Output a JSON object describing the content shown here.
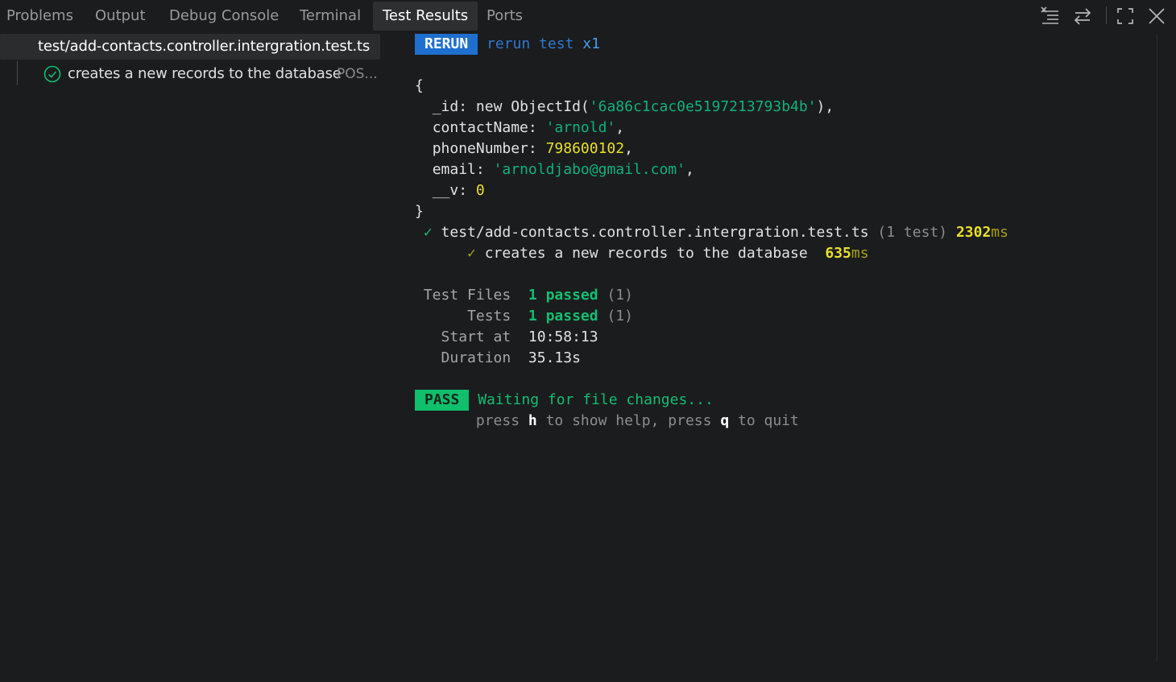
{
  "panel_tabs": [
    {
      "label": "Problems"
    },
    {
      "label": "Output"
    },
    {
      "label": "Debug Console"
    },
    {
      "label": "Terminal"
    },
    {
      "label": "Test Results"
    },
    {
      "label": "Ports"
    }
  ],
  "active_tab": "Test Results",
  "toolbar_icons": [
    "clear-list-icon",
    "toggle-output-icon",
    "maximize-icon",
    "close-icon"
  ],
  "test_tree": {
    "file": "test/add-contacts.controller.intergration.test.ts",
    "test": {
      "label": "creates a new records to the database",
      "description": "POS...",
      "status": "passed"
    }
  },
  "terminal": {
    "rerun_badge": "RERUN",
    "rerun_text": "rerun test",
    "rerun_count": "x1",
    "open_brace": "{",
    "record": {
      "id_key": "_id:",
      "id_call": "new ObjectId(",
      "id_value": "'6a86c1cac0e5197213793b4b'",
      "id_close": "),",
      "name_key": "contactName:",
      "name_value": "'arnold'",
      "phone_key": "phoneNumber:",
      "phone_value": "798600102",
      "email_key": "email:",
      "email_value": "'arnoldjabo@gmail.com'",
      "v_key": "__v:",
      "v_value": "0",
      "comma": ","
    },
    "close_brace": "}",
    "check_mark": "✓",
    "file_result": {
      "path": "test/add-contacts.controller.intergration.test.ts",
      "count": "(1 test)",
      "time": "2302",
      "unit": "ms"
    },
    "test_result": {
      "name": "creates a new records to the database",
      "time": "635",
      "unit": "ms"
    },
    "summary": {
      "files_label": "Test Files",
      "files_value": "1 passed",
      "files_count": "(1)",
      "tests_label": "Tests",
      "tests_value": "1 passed",
      "tests_count": "(1)",
      "start_label": "Start at",
      "start_value": "10:58:13",
      "duration_label": "Duration",
      "duration_value": "35.13s"
    },
    "pass_badge": "PASS",
    "waiting_text": "Waiting for file changes...",
    "help": {
      "press1": "press ",
      "key_h": "h",
      "mid": " to show help, press ",
      "key_q": "q",
      "end": " to quit"
    }
  },
  "colors": {
    "background": "#1b1c1e",
    "pass_green": "#12bf70",
    "rerun_blue": "#1f6fcf",
    "number_yellow": "#e8e02a"
  }
}
